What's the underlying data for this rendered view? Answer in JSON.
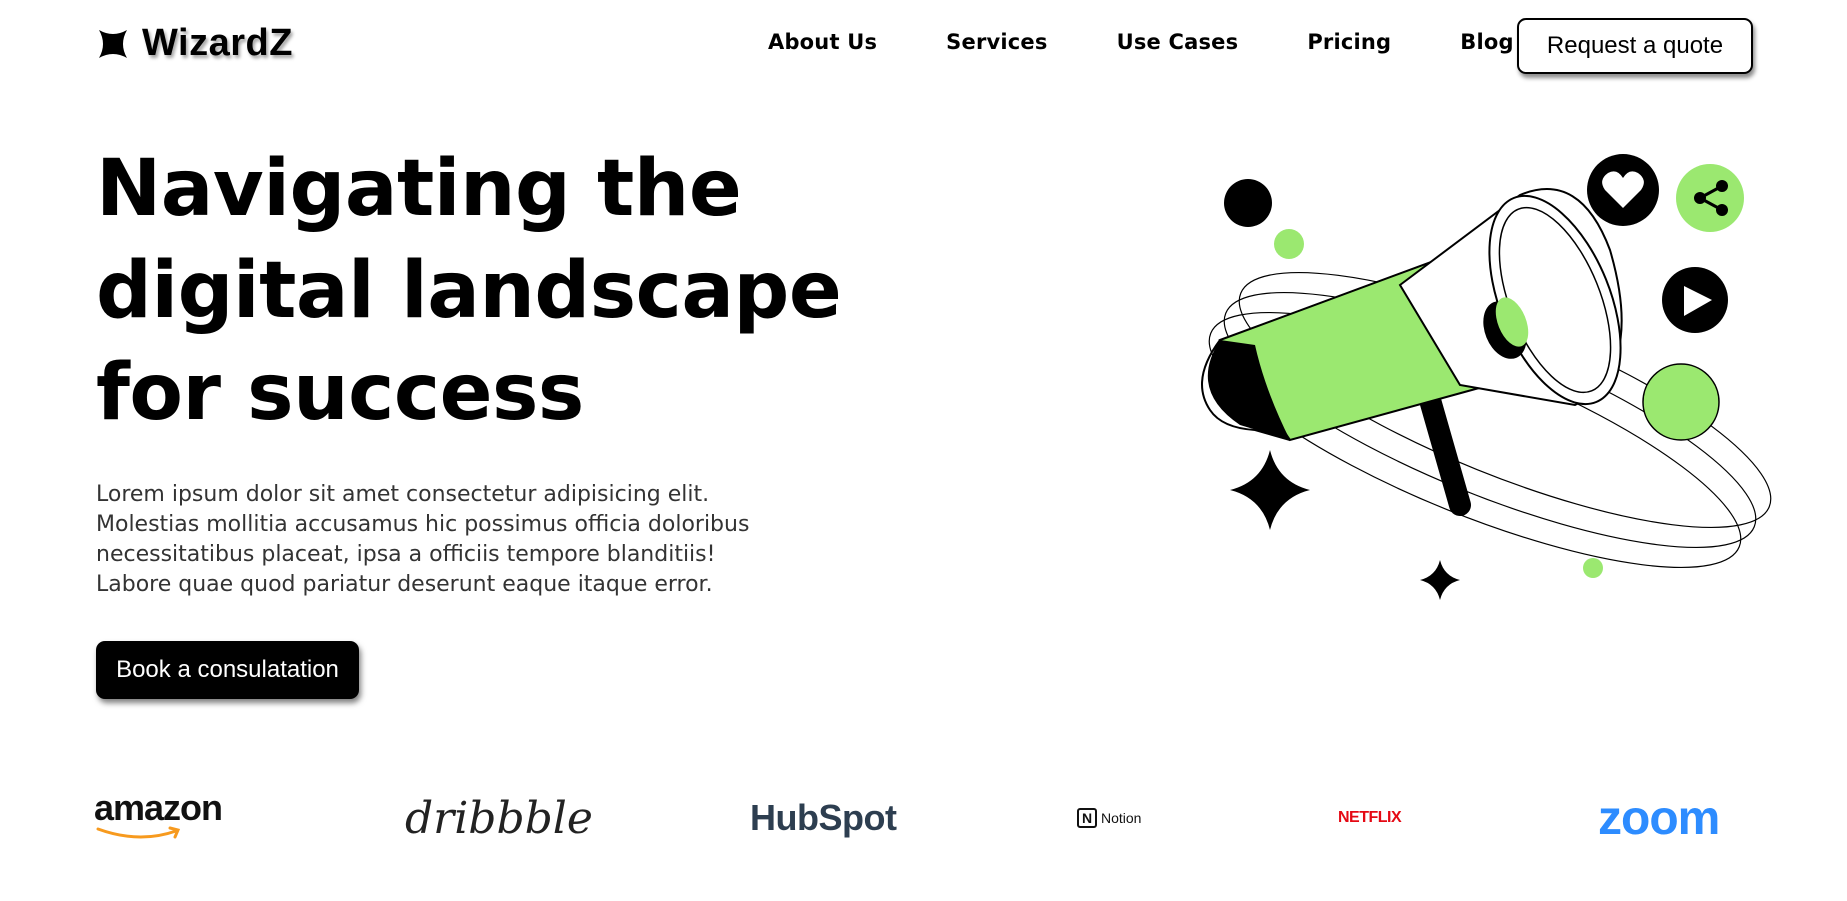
{
  "brand": {
    "name": "WizardZ",
    "logo_icon": "four-point-star-icon"
  },
  "nav": {
    "items": [
      {
        "label": "About Us"
      },
      {
        "label": "Services"
      },
      {
        "label": "Use Cases"
      },
      {
        "label": "Pricing"
      },
      {
        "label": "Blog"
      }
    ],
    "cta_label": "Request a quote"
  },
  "hero": {
    "title_lines": [
      "Navigating the",
      "digital landscape",
      "for success"
    ],
    "description_lines": [
      "Lorem ipsum dolor sit amet consectetur adipisicing elit.",
      "Molestias mollitia accusamus hic possimus officia doloribus",
      "necessitatibus placeat, ipsa a officiis tempore blanditiis!",
      "Labore quae quod pariatur deserunt eaque itaque error."
    ],
    "cta_label": "Book a consulatation"
  },
  "illustration": {
    "icons": [
      "megaphone-icon",
      "heart-icon",
      "share-icon",
      "play-icon",
      "sparkle-icon"
    ],
    "accent_color": "#9be870",
    "dark_color": "#000000"
  },
  "partners": {
    "amazon": "amazon",
    "dribbble": "dribbble",
    "hubspot": "HubSpot",
    "notion_mark": "N",
    "notion": "Notion",
    "netflix": "NETFLIX",
    "zoom": "zoom"
  },
  "colors": {
    "accent": "#9be870",
    "text": "#000000",
    "netflix": "#e50914",
    "zoom": "#2d8cff",
    "hubspot_spot": "#ff7a59"
  }
}
